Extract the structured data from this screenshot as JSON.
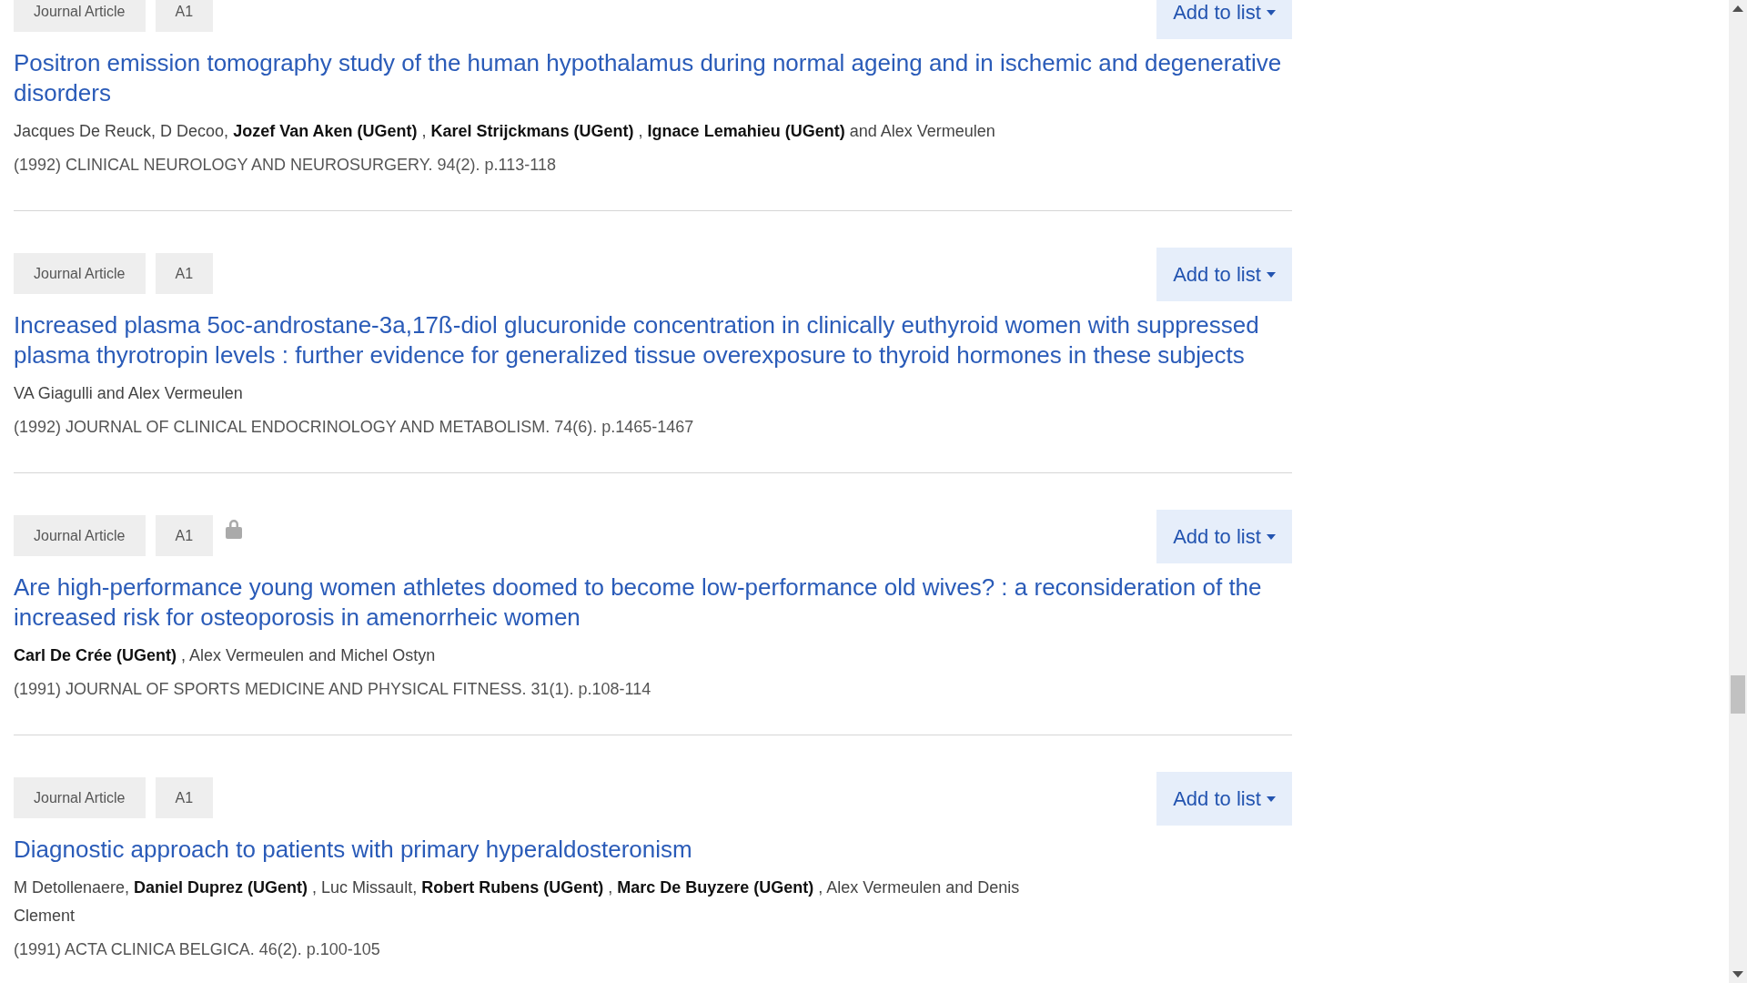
{
  "results": [
    {
      "badges": [
        "Journal Article",
        "A1"
      ],
      "locked": false,
      "button": "Add to list",
      "title": "Positron emission tomography study of the human hypothalamus during normal ageing and in ischemic and degenerative disorders",
      "authors": "Jacques De Reuck, D Decoo, **Jozef Van Aken (UGent)** , **Karel Strijckmans (UGent)** , **Ignace Lemahieu (UGent)** and Alex Vermeulen",
      "citation": "(1992) CLINICAL NEUROLOGY AND NEUROSURGERY. 94(2). p.113-118"
    },
    {
      "badges": [
        "Journal Article",
        "A1"
      ],
      "locked": false,
      "button": "Add to list",
      "title": "Increased plasma 5oc-androstane-3a,17ß-diol glucuronide concentration in clinically euthyroid women with suppressed plasma thyrotropin levels : further evidence for generalized tissue overexposure to thyroid hormones in these subjects",
      "authors": "VA Giagulli and Alex Vermeulen",
      "citation": "(1992) JOURNAL OF CLINICAL ENDOCRINOLOGY AND METABOLISM. 74(6). p.1465-1467"
    },
    {
      "badges": [
        "Journal Article",
        "A1"
      ],
      "locked": true,
      "button": "Add to list",
      "title": "Are high-performance young women athletes doomed to become low-performance old wives? : a reconsideration of the increased risk for osteoporosis in amenorrheic women",
      "authors": "**Carl De Crée (UGent)** , Alex Vermeulen and Michel Ostyn",
      "citation": "(1991) JOURNAL OF SPORTS MEDICINE AND PHYSICAL FITNESS. 31(1). p.108-114"
    },
    {
      "badges": [
        "Journal Article",
        "A1"
      ],
      "locked": false,
      "button": "Add to list",
      "title": "Diagnostic approach to patients with primary hyperaldosteronism",
      "authors": "M Detollenaere, **Daniel Duprez (UGent)** , Luc Missault, **Robert Rubens (UGent)** , **Marc De Buyzere (UGent)** , Alex Vermeulen and Denis Clement",
      "citation": "(1991) ACTA CLINICA BELGICA. 46(2). p.100-105"
    }
  ]
}
